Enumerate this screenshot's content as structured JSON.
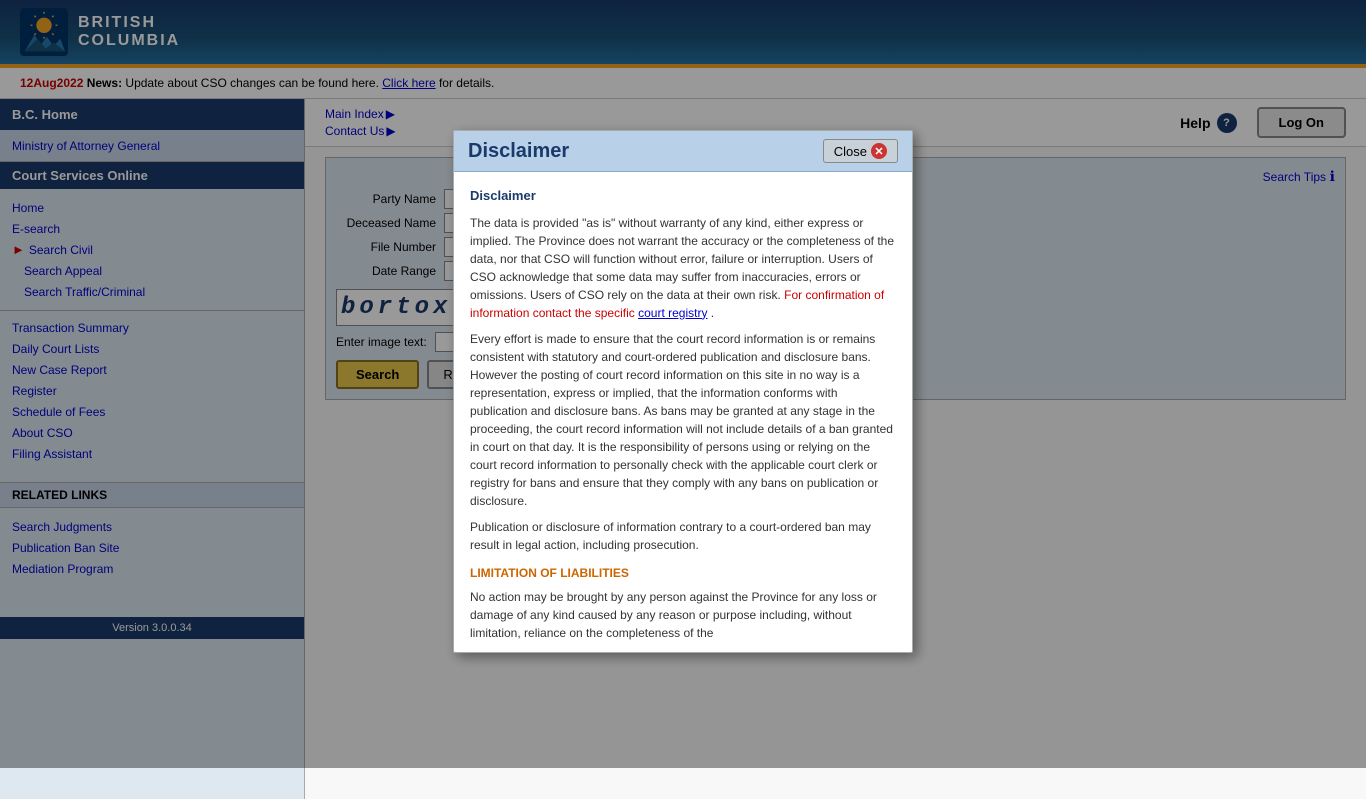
{
  "header": {
    "title_line1": "BRITISH",
    "title_line2": "COLUMBIA"
  },
  "news": {
    "date": "12Aug2022",
    "label": "News:",
    "text": "Update about CSO changes can be found here.",
    "link_text": "Click here",
    "link_suffix": "for details."
  },
  "top_links": {
    "main_index": "Main Index",
    "contact_us": "Contact Us",
    "help": "Help"
  },
  "logon": {
    "label": "Log On"
  },
  "sidebar": {
    "bc_home": "B.C. Home",
    "ministry": "Ministry of Attorney General",
    "cso": "Court Services Online",
    "nav_items": [
      {
        "label": "Home",
        "active": false
      },
      {
        "label": "E-search",
        "active": false
      },
      {
        "label": "Search Civil",
        "active": true
      },
      {
        "label": "Search Appeal",
        "active": false
      },
      {
        "label": "Search Traffic/Criminal",
        "active": false
      }
    ],
    "other_items": [
      "Transaction Summary",
      "Daily Court Lists",
      "New Case Report",
      "Register",
      "Schedule of Fees",
      "About CSO",
      "Filing Assistant"
    ],
    "related_links": "RELATED LINKS",
    "related_items": [
      "Search Judgments",
      "Publication Ban Site",
      "Mediation Program"
    ],
    "version": "Version 3.0.0.34"
  },
  "search_panel": {
    "tips_label": "Search Tips",
    "party_name_label": "Party Name",
    "deceased_name_label": "Deceased Name",
    "file_number_label": "File Number",
    "date_range_label": "Date Range",
    "captcha_text": "bortox",
    "enter_image_label": "Enter image text:",
    "search_btn": "Search",
    "reset_btn": "Reset"
  },
  "modal": {
    "title": "Disclaimer",
    "close_label": "Close",
    "heading": "Disclaimer",
    "para1": "The data is provided \"as is\" without warranty of any kind, either express or implied. The Province does not warrant the accuracy or the completeness of the data, nor that CSO will function without error, failure or interruption. Users of CSO acknowledge that some data may suffer from inaccuracies, errors or omissions. Users of CSO rely on the data at their own risk.",
    "red_text": "For confirmation of information contact the specific",
    "court_registry_link": "court registry",
    "para1_end": ".",
    "para2": "Every effort is made to ensure that the court record information is or remains consistent with statutory and court-ordered publication and disclosure bans. However the posting of court record information on this site in no way is a representation, express or implied, that the information conforms with publication and disclosure bans. As bans may be granted at any stage in the proceeding, the court record information will not include details of a ban granted in court on that day. It is the responsibility of persons using or relying on the court record information to personally check with the applicable court clerk or registry for bans and ensure that they comply with any bans on publication or disclosure.",
    "para3": "Publication or disclosure of information contrary to a court-ordered ban may result in legal action, including prosecution.",
    "limitation_heading": "LIMITATION OF LIABILITIES",
    "para4": "No action may be brought by any person against the Province for any loss or damage of any kind caused by any reason or purpose including, without limitation, reliance on the completeness of the"
  }
}
